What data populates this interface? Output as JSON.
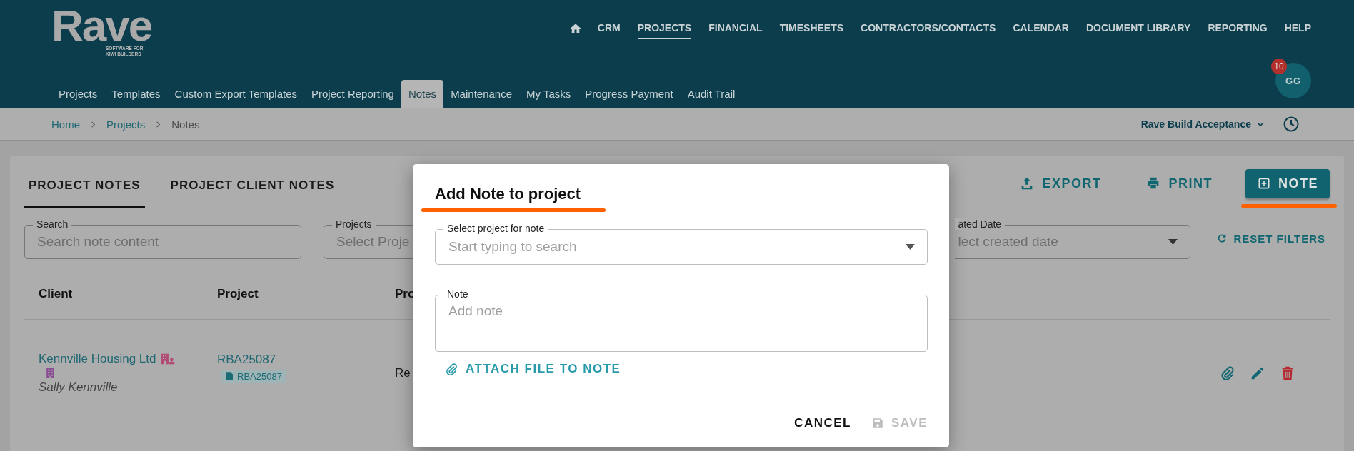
{
  "header": {
    "logo": "Rave",
    "tagline": [
      "SOFTWARE FOR",
      "KIWI BUILDERS"
    ]
  },
  "top_nav": [
    {
      "label": "CRM",
      "selected": false
    },
    {
      "label": "PROJECTS",
      "selected": true
    },
    {
      "label": "FINANCIAL",
      "selected": false
    },
    {
      "label": "TIMESHEETS",
      "selected": false
    },
    {
      "label": "CONTRACTORS/CONTACTS",
      "selected": false
    },
    {
      "label": "CALENDAR",
      "selected": false
    },
    {
      "label": "DOCUMENT LIBRARY",
      "selected": false
    },
    {
      "label": "REPORTING",
      "selected": false
    },
    {
      "label": "HELP",
      "selected": false
    }
  ],
  "sub_nav": [
    {
      "label": "Projects",
      "selected": false
    },
    {
      "label": "Templates",
      "selected": false
    },
    {
      "label": "Custom Export Templates",
      "selected": false
    },
    {
      "label": "Project Reporting",
      "selected": false
    },
    {
      "label": "Notes",
      "selected": true
    },
    {
      "label": "Maintenance",
      "selected": false
    },
    {
      "label": "My Tasks",
      "selected": false
    },
    {
      "label": "Progress Payment",
      "selected": false
    },
    {
      "label": "Audit Trail",
      "selected": false
    }
  ],
  "user": {
    "initials": "GG",
    "notifications": "10"
  },
  "breadcrumb": [
    "Home",
    "Projects",
    "Notes"
  ],
  "company": "Rave Build Acceptance",
  "page_tabs": [
    {
      "label": "PROJECT NOTES",
      "selected": true
    },
    {
      "label": "PROJECT CLIENT NOTES",
      "selected": false
    }
  ],
  "actions": [
    {
      "label": "EXPORT",
      "kind": "export"
    },
    {
      "label": "PRINT",
      "kind": "print"
    },
    {
      "label": "NOTE",
      "kind": "add"
    }
  ],
  "filters": [
    {
      "label": "Search",
      "placeholder": "Search note content",
      "kind": "text"
    },
    {
      "label": "Projects",
      "placeholder": "Select Proje",
      "kind": "text"
    },
    {
      "label": "ated Date",
      "placeholder": "lect created date",
      "kind": "select"
    }
  ],
  "reset_filters": "RESET FILTERS",
  "table": {
    "columns": [
      "Client",
      "Project",
      "Pro"
    ],
    "rows": [
      {
        "client": "Kennville Housing Ltd",
        "contact": "Sally Kennville",
        "project": "RBA25087",
        "project_tag": "RBA25087",
        "column_3": "Re"
      }
    ]
  },
  "modal": {
    "title": "Add Note to project",
    "fields": [
      {
        "label": "Select project for note",
        "placeholder": "Start typing to search",
        "kind": "select"
      },
      {
        "label": "Note",
        "placeholder": "Add note",
        "kind": "textarea"
      }
    ],
    "attach": "ATTACH FILE TO NOTE",
    "buttons": [
      {
        "label": "CANCEL",
        "kind": "cancel",
        "disabled": false
      },
      {
        "label": "SAVE",
        "kind": "save",
        "disabled": true
      }
    ]
  }
}
